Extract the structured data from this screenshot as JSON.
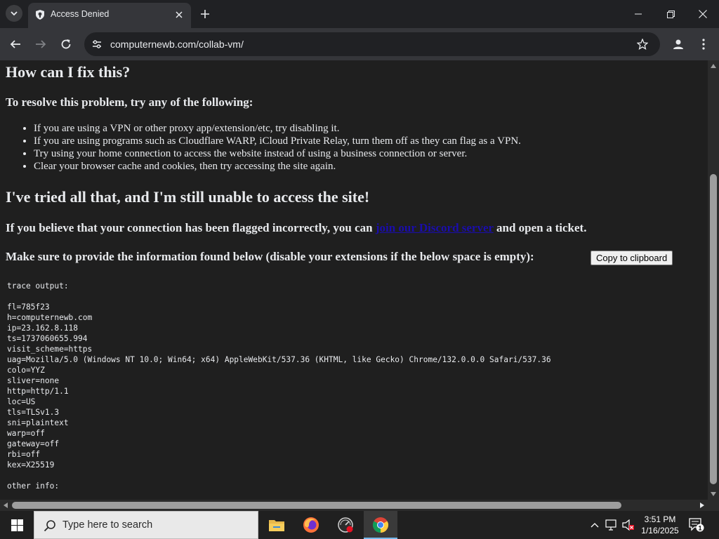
{
  "browser": {
    "tab_title": "Access Denied",
    "url": "computernewb.com/collab-vm/"
  },
  "page": {
    "fix_heading": "How can I fix this?",
    "resolve_heading": "To resolve this problem, try any of the following:",
    "tips": [
      "If you are using a VPN or other proxy app/extension/etc, try disabling it.",
      "If you are using programs such as Cloudflare WARP, iCloud Private Relay, turn them off as they can flag as a VPN.",
      "Try using your home connection to access the website instead of using a business connection or server.",
      "Clear your browser cache and cookies, then try accessing the site again."
    ],
    "still_heading": "I've tried all that, and I'm still unable to access the site!",
    "flagged_before": "If you believe that your connection has been flagged incorrectly, you can ",
    "flagged_link": "join our Discord server",
    "flagged_after": " and open a ticket.",
    "provide_text": "Make sure to provide the information found below (disable your extensions if the below space is empty): ",
    "copy_button": "Copy to clipboard",
    "trace_title": "trace output:",
    "trace_lines": [
      "fl=785f23",
      "h=computernewb.com",
      "ip=23.162.8.118",
      "ts=1737060655.994",
      "visit_scheme=https",
      "uag=Mozilla/5.0 (Windows NT 10.0; Win64; x64) AppleWebKit/537.36 (KHTML, like Gecko) Chrome/132.0.0.0 Safari/537.36",
      "colo=YYZ",
      "sliver=none",
      "http=http/1.1",
      "loc=US",
      "tls=TLSv1.3",
      "sni=plaintext",
      "warp=off",
      "gateway=off",
      "rbi=off",
      "kex=X25519"
    ],
    "other_info": "other info:"
  },
  "taskbar": {
    "search_placeholder": "Type here to search",
    "time": "3:51 PM",
    "date": "1/16/2025",
    "notification_count": "1"
  },
  "colors": {
    "page_bg": "#1f1f1f",
    "link": "#1a0dab",
    "toolbar_bg": "#35363a",
    "taskbar_bg": "#202020"
  }
}
